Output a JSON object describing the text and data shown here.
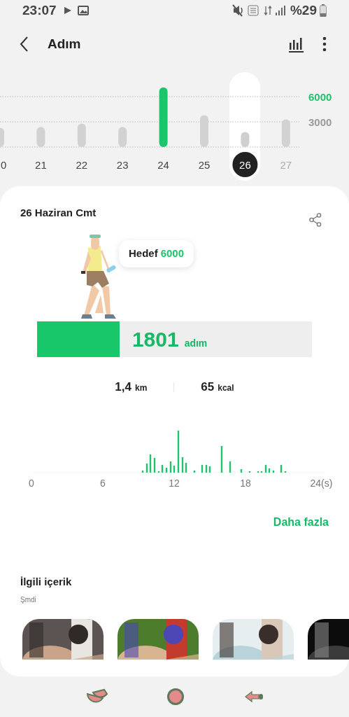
{
  "status_bar": {
    "time": "23:07",
    "battery_text": "%29"
  },
  "header": {
    "title": "Adım"
  },
  "week_chart": {
    "days": [
      {
        "label": "0",
        "selected": false
      },
      {
        "label": "21",
        "selected": false
      },
      {
        "label": "22",
        "selected": false
      },
      {
        "label": "23",
        "selected": false
      },
      {
        "label": "24",
        "selected": false
      },
      {
        "label": "25",
        "selected": false
      },
      {
        "label": "26",
        "selected": true
      },
      {
        "label": "27",
        "selected": false
      }
    ],
    "chart_data": {
      "type": "bar",
      "values": [
        2300,
        2400,
        2800,
        2400,
        7100,
        3800,
        1800,
        3300
      ],
      "yticks": [
        3000,
        6000
      ],
      "ylim": [
        0,
        7200
      ]
    }
  },
  "day_card": {
    "date": "26 Haziran Cmt",
    "goal_label": "Hedef",
    "goal_value": "6000",
    "steps": "1801",
    "steps_unit": "adım",
    "level": 0.3,
    "stats": [
      {
        "value": "1,4",
        "unit": "km"
      },
      {
        "value": "65",
        "unit": "kcal"
      }
    ],
    "hourly_axis": [
      "0",
      "6",
      "12",
      "18",
      "24(s)"
    ],
    "more_link": "Daha fazla"
  },
  "related": {
    "title": "İlgili içerik",
    "subtitle": "Şmdi"
  }
}
